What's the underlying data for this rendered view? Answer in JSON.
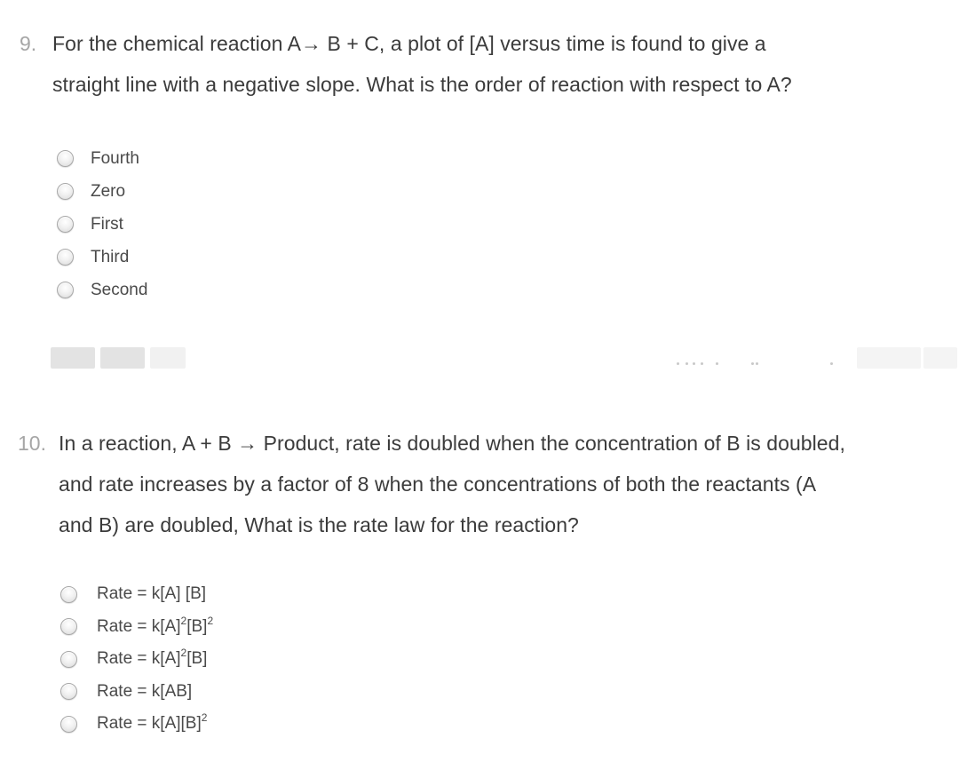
{
  "questions": [
    {
      "number": "9.",
      "text_lines": [
        "For the chemical reaction A→  B + C, a plot of [A] versus time is found to give a",
        "straight line with a negative slope. What is the order of reaction with respect to A?"
      ],
      "options": [
        {
          "label": "Fourth",
          "selected": false
        },
        {
          "label": "Zero",
          "selected": false
        },
        {
          "label": "First",
          "selected": false
        },
        {
          "label": "Third",
          "selected": false
        },
        {
          "label": "Second",
          "selected": false
        }
      ]
    },
    {
      "number": "10.",
      "text_lines": [
        "In a reaction, A + B → Product, rate is doubled when the concentration of B is doubled,",
        "and rate increases by a factor of 8 when the concentrations of both the reactants (A",
        "and B) are doubled, What is the rate law for the reaction?"
      ],
      "options": [
        {
          "base": "Rate = k[A] [B]",
          "parts": [
            {
              "t": "Rate = k[A] [B]"
            }
          ],
          "selected": false
        },
        {
          "base": "Rate = k[A]2[B]2",
          "parts": [
            {
              "t": "Rate = k[A]"
            },
            {
              "sup": "2"
            },
            {
              "t": "[B]"
            },
            {
              "sup": "2"
            }
          ],
          "selected": false
        },
        {
          "base": "Rate = k[A]2[B]",
          "parts": [
            {
              "t": "Rate = k[A]"
            },
            {
              "sup": "2"
            },
            {
              "t": "[B]"
            }
          ],
          "selected": false
        },
        {
          "base": "Rate = k[AB]",
          "parts": [
            {
              "t": "Rate = k[AB]"
            }
          ],
          "selected": false
        },
        {
          "base": "Rate = k[A][B]2",
          "parts": [
            {
              "t": "Rate = k[A][B]"
            },
            {
              "sup": "2"
            }
          ],
          "selected": false
        }
      ]
    }
  ],
  "toolbar": {
    "state": "faded/clipped",
    "icons": [
      "toolbar-button-icon",
      "toolbar-button-icon",
      "toolbar-button-icon",
      "toolbar-button-icon",
      "toolbar-button-icon"
    ]
  }
}
